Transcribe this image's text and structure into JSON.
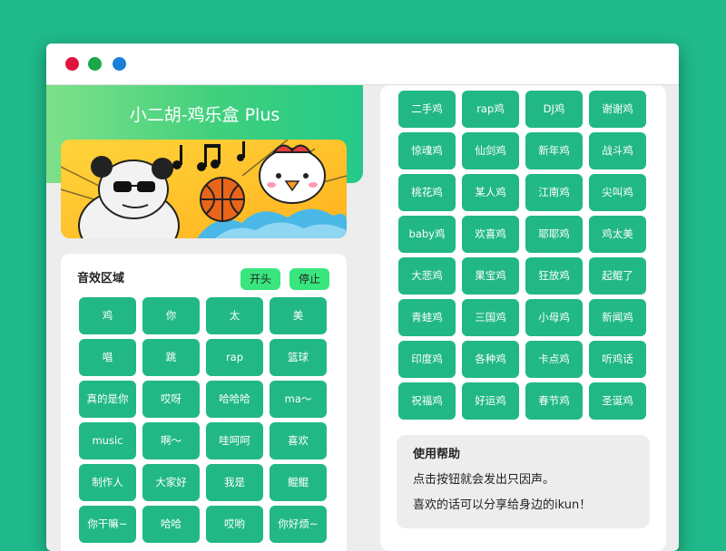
{
  "app": {
    "title": "小二胡-鸡乐盒 Plus"
  },
  "sound_section": {
    "title": "音效区域",
    "start_label": "开头",
    "stop_label": "停止",
    "buttons": [
      "鸡",
      "你",
      "太",
      "美",
      "唱",
      "跳",
      "rap",
      "篮球",
      "真的是你",
      "哎呀",
      "哈哈哈",
      "ma～",
      "music",
      "啊～",
      "哇呵呵",
      "喜欢",
      "制作人",
      "大家好",
      "我是",
      "鲲鲲",
      "你干嘛~",
      "哈哈",
      "哎哟",
      "你好烦~"
    ]
  },
  "chicken_section": {
    "buttons": [
      "二手鸡",
      "rap鸡",
      "DJ鸡",
      "谢谢鸡",
      "惊魂鸡",
      "仙剑鸡",
      "新年鸡",
      "战斗鸡",
      "桃花鸡",
      "某人鸡",
      "江南鸡",
      "尖叫鸡",
      "baby鸡",
      "欢喜鸡",
      "耶耶鸡",
      "鸡太美",
      "大悲鸡",
      "果宝鸡",
      "狂放鸡",
      "起鲲了",
      "青蛙鸡",
      "三国鸡",
      "小母鸡",
      "新闻鸡",
      "印度鸡",
      "各种鸡",
      "卡点鸡",
      "听鸡话",
      "祝福鸡",
      "好运鸡",
      "春节鸡",
      "圣诞鸡"
    ]
  },
  "help": {
    "title": "使用帮助",
    "line1": "点击按钮就会发出只因声。",
    "line2": "喜欢的话可以分享给身边的ikun！"
  },
  "colors": {
    "background": "#1fb98a",
    "button": "#21b886",
    "control_button": "#39e67e",
    "hero_gradient_start": "#7fe08a",
    "hero_gradient_end": "#24c98a"
  }
}
